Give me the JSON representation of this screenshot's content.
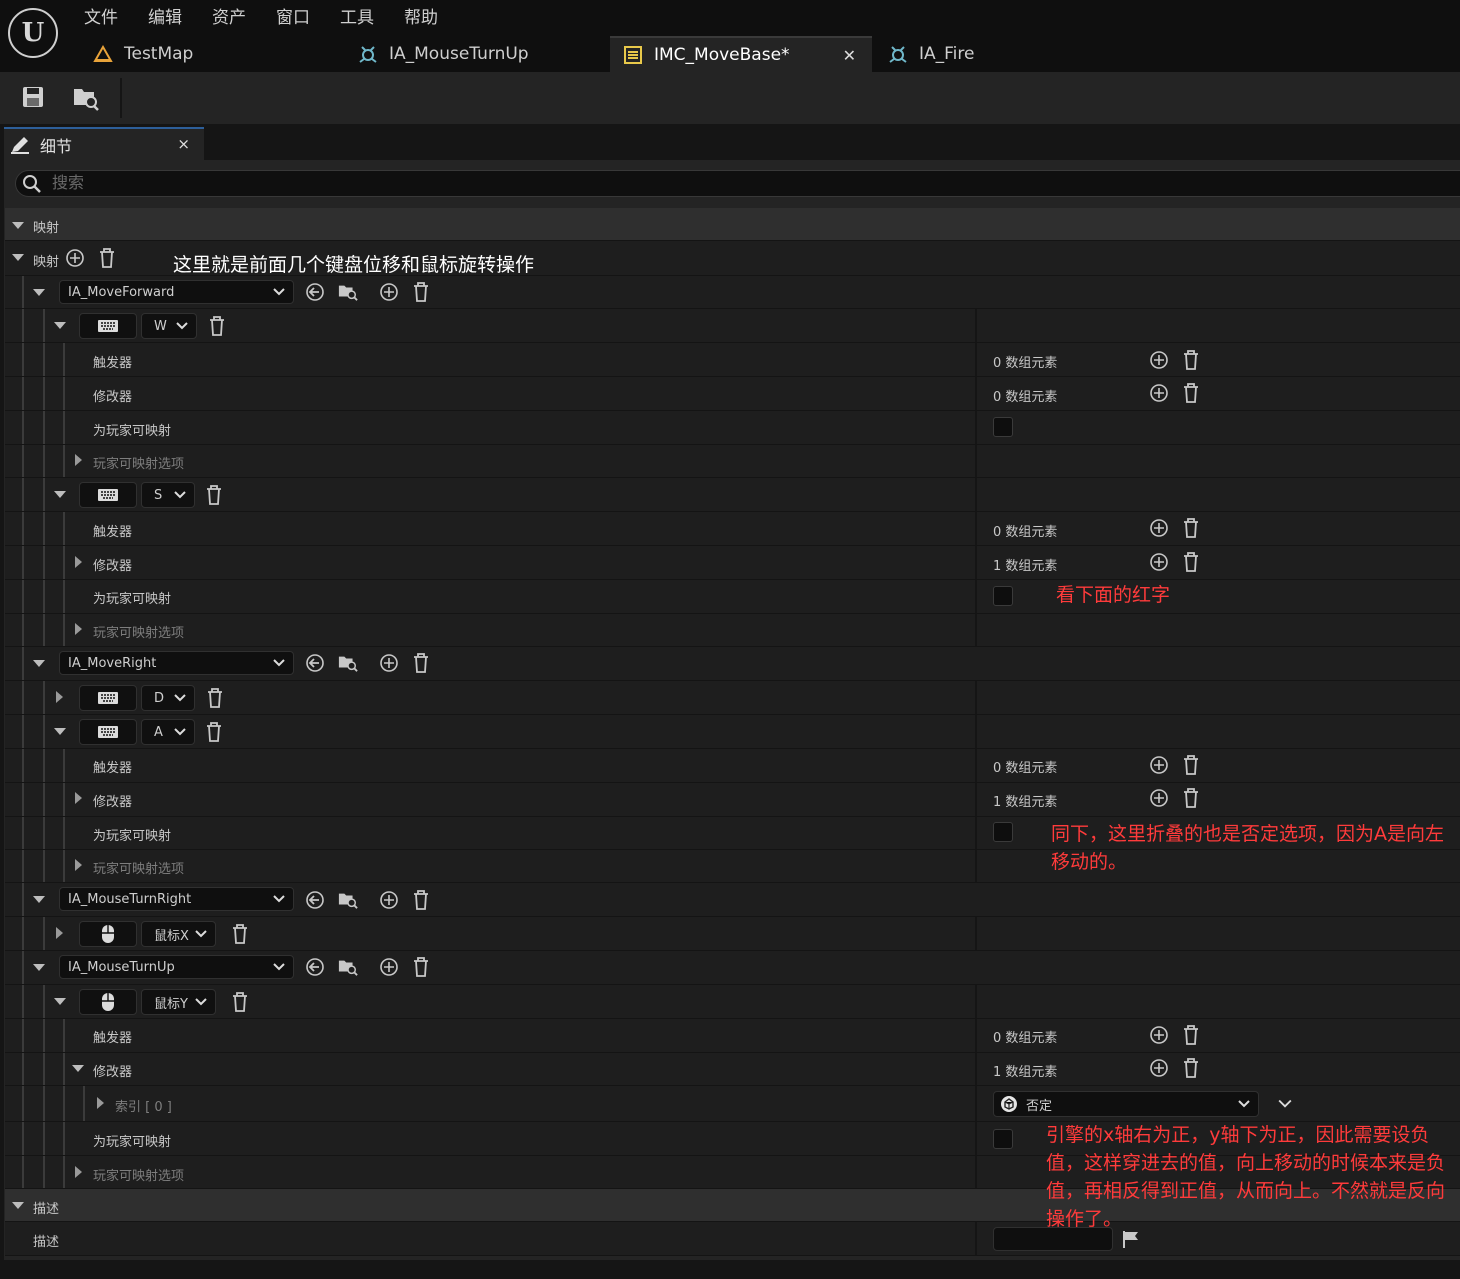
{
  "menu": [
    "文件",
    "编辑",
    "资产",
    "窗口",
    "工具",
    "帮助"
  ],
  "tabs": [
    {
      "label": "TestMap"
    },
    {
      "label": "IA_MouseTurnUp"
    },
    {
      "label": "IMC_MoveBase*"
    },
    {
      "label": "IA_Fire"
    }
  ],
  "details_tab": {
    "label": "细节",
    "close": "×"
  },
  "search": {
    "placeholder": "搜索"
  },
  "sections": {
    "mapping": "映射",
    "description": "描述"
  },
  "labels": {
    "mappings": "映射",
    "triggers": "触发器",
    "modifiers": "修改器",
    "player_mappable": "为玩家可映射",
    "player_options": "玩家可映射选项",
    "index0": "索引 [ 0 ]",
    "description": "描述"
  },
  "actions": [
    "IA_MoveForward",
    "IA_MoveRight",
    "IA_MouseTurnRight",
    "IA_MouseTurnUp"
  ],
  "keys": [
    "W",
    "S",
    "D",
    "A",
    "鼠标X",
    "鼠标Y"
  ],
  "values": {
    "zero_elements": "0 数组元素",
    "one_element": "1 数组元素",
    "negate": "否定"
  },
  "annotations": {
    "top": "这里就是前面几个键盘位移和鼠标旋转操作",
    "s_note": "看下面的红字",
    "a_note": "同下，这里折叠的也是否定选项，因为A是向左移动的。",
    "y_note": "引擎的x轴右为正，y轴下为正，因此需要设负值，这样穿进去的值，向上移动的时候本来是负值，再相反得到正值，从而向上。不然就是反向操作了。"
  },
  "colors": {
    "annotation_red": "#ff3b3b",
    "annotation_white": "#ffffff",
    "accent": "#2d5f9a",
    "map_icon": "#e8a33a",
    "action_icon": "#6fb7c9"
  }
}
